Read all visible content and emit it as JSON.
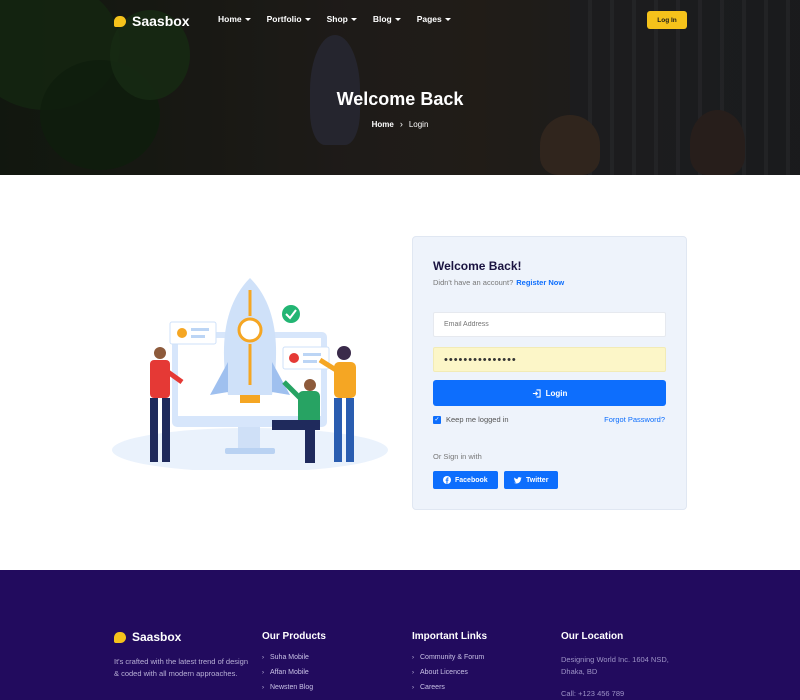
{
  "brand": {
    "name": "Saasbox"
  },
  "nav": {
    "items": [
      {
        "label": "Home"
      },
      {
        "label": "Portfolio"
      },
      {
        "label": "Shop"
      },
      {
        "label": "Blog"
      },
      {
        "label": "Pages"
      }
    ],
    "login_label": "Log In"
  },
  "hero": {
    "title": "Welcome Back",
    "breadcrumb": {
      "home": "Home",
      "separator": "›",
      "current": "Login"
    }
  },
  "login": {
    "title": "Welcome Back!",
    "subtitle": "Didn't have an account?",
    "register_link": "Register Now",
    "email_placeholder": "Email Address",
    "password_value": "•••••••••••••••",
    "submit_label": "Login",
    "remember_label": "Keep me logged in",
    "remember_checked": true,
    "forgot_label": "Forgot Password?",
    "or_label": "Or Sign in with",
    "social": [
      {
        "label": "Facebook",
        "icon": "facebook-icon"
      },
      {
        "label": "Twitter",
        "icon": "twitter-icon"
      }
    ]
  },
  "footer": {
    "brand": "Saasbox",
    "about": "It's crafted with the latest trend of design & coded with all modern approaches.",
    "products": {
      "title": "Our Products",
      "items": [
        "Suha Mobile",
        "Affan Mobile",
        "Newsten Blog"
      ]
    },
    "links": {
      "title": "Important Links",
      "items": [
        "Community & Forum",
        "About Licences",
        "Careers"
      ]
    },
    "location": {
      "title": "Our Location",
      "address": "Designing World Inc. 1604 NSD, Dhaka, BD",
      "phone": "Call: +123 456 789"
    }
  },
  "colors": {
    "accent": "#f5c21b",
    "primary": "#0d6efd",
    "footer_bg": "#220b5e"
  }
}
